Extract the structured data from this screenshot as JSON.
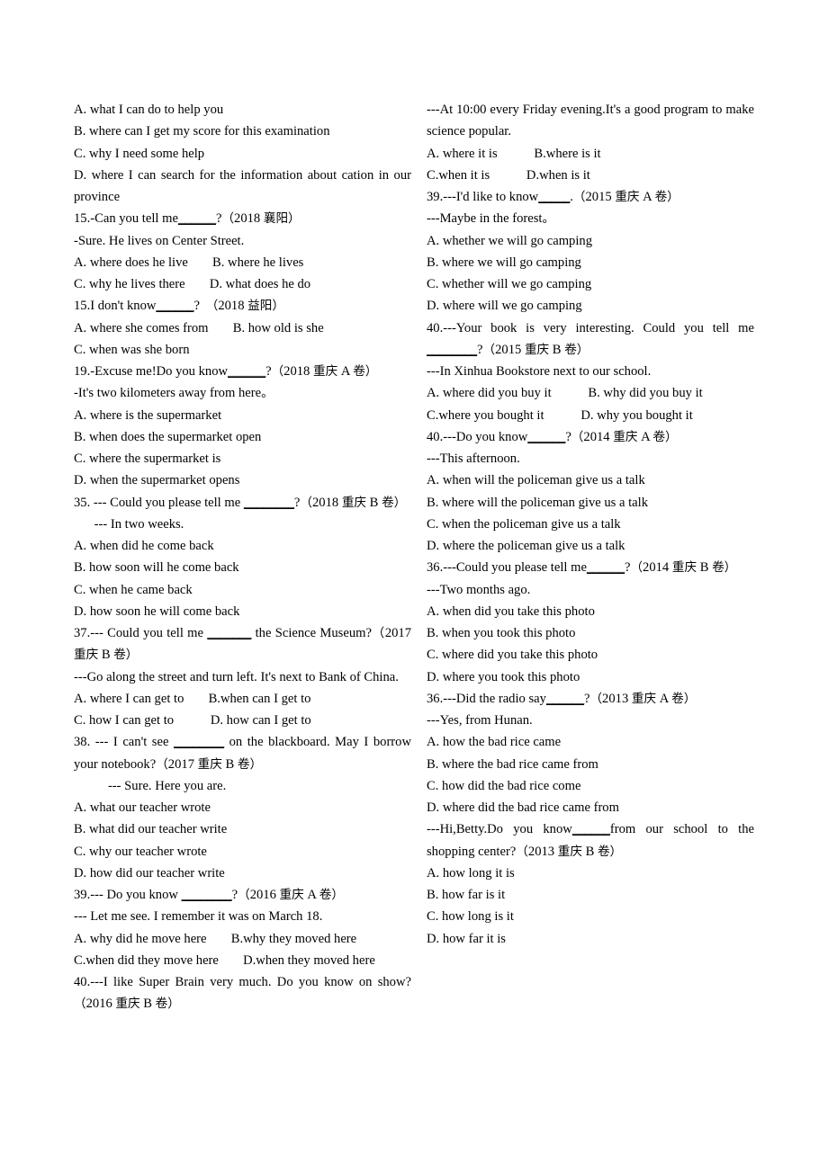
{
  "document": {
    "kind": "english-grammar-worksheet",
    "topic": "indirect-questions-multiple-choice",
    "page_background": "#ffffff",
    "text_color": "#000000"
  },
  "left_column": {
    "lines": [
      {
        "id": "l1",
        "text": "A. what I can do to help you"
      },
      {
        "id": "l2",
        "text": "B. where can I get my score for this examination"
      },
      {
        "id": "l3",
        "text": "C. why I need some help"
      },
      {
        "id": "l4",
        "text": "D. where I can search for the information about cation in our province"
      },
      {
        "id": "l5",
        "text": "15.-Can you tell me______?（2018 襄阳）"
      },
      {
        "id": "l6",
        "text": "-Sure. He lives on Center Street."
      },
      {
        "id": "l7",
        "text": "A. where does he live　　B. where he lives"
      },
      {
        "id": "l8",
        "text": "C. why he lives there　　D. what does he do"
      },
      {
        "id": "l9",
        "text": "15.I don't know______?　（2018 益阳）"
      },
      {
        "id": "l10",
        "text": "A. where she comes from　　B. how old is she"
      },
      {
        "id": "l11",
        "text": "C. when was she born"
      },
      {
        "id": "l12",
        "text": "19.-Excuse me!Do you know______?（2018 重庆 A 卷）"
      },
      {
        "id": "l13",
        "text": "-It's two kilometers away from here。"
      },
      {
        "id": "l14",
        "text": "A. where is the supermarket"
      },
      {
        "id": "l15",
        "text": "B. when does the supermarket open"
      },
      {
        "id": "l16",
        "text": "C. where the supermarket is"
      },
      {
        "id": "l17",
        "text": "D. when the supermarket opens"
      },
      {
        "id": "l18",
        "text": "35. --- Could you please tell me ________?（2018 重庆 B 卷）"
      },
      {
        "id": "l19",
        "text": "--- In two weeks."
      },
      {
        "id": "l20",
        "text": "A. when did he come back"
      },
      {
        "id": "l21",
        "text": "B. how soon will he come back"
      },
      {
        "id": "l22",
        "text": "C. when he came back"
      },
      {
        "id": "l23",
        "text": "D. how soon he will come back"
      },
      {
        "id": "l24",
        "text": "37.--- Could you tell me _______ the Science Museum?（2017 重庆 B 卷）"
      },
      {
        "id": "l25",
        "text": "---Go along the street and turn left. It's next to Bank of China."
      },
      {
        "id": "l26",
        "text": "A. where I can get to　　B.when can I get to"
      },
      {
        "id": "l27",
        "text": "C. how I can get to　　　D. how can I get to"
      },
      {
        "id": "l28",
        "text": "38. --- I can't see ________ on the blackboard. May I borrow your notebook?（2017 重庆 B 卷）"
      },
      {
        "id": "l29",
        "text": "--- Sure. Here you are."
      },
      {
        "id": "l30",
        "text": "A. what our teacher wrote"
      },
      {
        "id": "l31",
        "text": "B. what did our teacher write"
      },
      {
        "id": "l32",
        "text": "C. why our teacher wrote"
      },
      {
        "id": "l33",
        "text": "D. how did our teacher write"
      },
      {
        "id": "l34",
        "text": "39.--- Do you know ________?（2016 重庆 A 卷）"
      },
      {
        "id": "l35",
        "text": "--- Let me see. I remember it was on March 18."
      },
      {
        "id": "l36",
        "text": "A. why did he move here　　B.why they moved here"
      },
      {
        "id": "l37",
        "text": "C.when did they move here　　D.when they moved here"
      },
      {
        "id": "l38",
        "text": "40.---I like Super Brain very much. Do you know on show?（2016 重庆 B 卷）"
      }
    ]
  },
  "right_column": {
    "lines": [
      {
        "id": "r1",
        "text": "---At 10:00 every Friday evening.It's a good program to make science popular."
      },
      {
        "id": "r2",
        "text": "A. where it is　　　B.where is it"
      },
      {
        "id": "r3",
        "text": "C.when it is　　　D.when is it"
      },
      {
        "id": "r4",
        "text": "39.---I'd like to know_____.（2015 重庆 A 卷）"
      },
      {
        "id": "r5",
        "text": "---Maybe in the forest。"
      },
      {
        "id": "r6",
        "text": "A. whether we will go camping"
      },
      {
        "id": "r7",
        "text": "B. where we will go camping"
      },
      {
        "id": "r8",
        "text": "C. whether will we go camping"
      },
      {
        "id": "r9",
        "text": "D. where will we go camping"
      },
      {
        "id": "r10",
        "text": "40.---Your book is very interesting. Could you tell me ________?（2015 重庆 B 卷）"
      },
      {
        "id": "r11",
        "text": "---In Xinhua Bookstore next to our school."
      },
      {
        "id": "r12",
        "text": "A. where did you buy it　　　B. why did you buy it"
      },
      {
        "id": "r13",
        "text": "C.where you bought it　　　D. why you bought it"
      },
      {
        "id": "r14",
        "text": "40.---Do you know______?（2014 重庆 A 卷）"
      },
      {
        "id": "r15",
        "text": "---This afternoon."
      },
      {
        "id": "r16",
        "text": "A. when will the policeman give us a talk"
      },
      {
        "id": "r17",
        "text": "B. where will the policeman give us a talk"
      },
      {
        "id": "r18",
        "text": "C. when the policeman give us a talk"
      },
      {
        "id": "r19",
        "text": "D. where the policeman give us a talk"
      },
      {
        "id": "r20",
        "text": "36.---Could you please tell me______?（2014 重庆 B 卷）"
      },
      {
        "id": "r21",
        "text": "---Two months ago."
      },
      {
        "id": "r22",
        "text": "A. when did you take this photo"
      },
      {
        "id": "r23",
        "text": "B. when you took this photo"
      },
      {
        "id": "r24",
        "text": "C. where did you take this photo"
      },
      {
        "id": "r25",
        "text": "D. where you took this photo"
      },
      {
        "id": "r26",
        "text": "36.---Did the radio say______?（2013 重庆 A 卷）"
      },
      {
        "id": "r27",
        "text": "---Yes, from Hunan."
      },
      {
        "id": "r28",
        "text": "A.  how the bad rice came"
      },
      {
        "id": "r29",
        "text": "B.  where the bad rice came from"
      },
      {
        "id": "r30",
        "text": "C.  how did the bad rice come"
      },
      {
        "id": "r31",
        "text": "D.  where did the bad rice came from"
      },
      {
        "id": "r32",
        "text": "---Hi,Betty.Do you know______from our school to the shopping center?（2013 重庆 B 卷）"
      },
      {
        "id": "r33",
        "text": "A. how long it is"
      },
      {
        "id": "r34",
        "text": "B. how far is it"
      },
      {
        "id": "r35",
        "text": "C. how long is it"
      },
      {
        "id": "r36",
        "text": "D. how far it is"
      }
    ]
  }
}
